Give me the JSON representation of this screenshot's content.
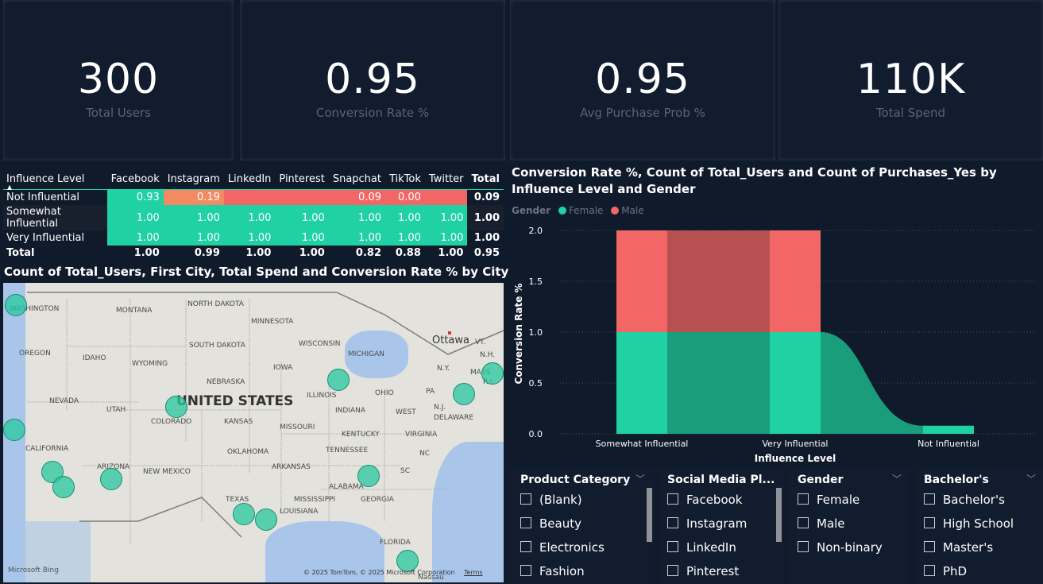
{
  "kpis": [
    {
      "value": "300",
      "label": "Total Users"
    },
    {
      "value": "0.95",
      "label": "Conversion Rate %"
    },
    {
      "value": "0.95",
      "label": "Avg Purchase Prob %"
    },
    {
      "value": "110K",
      "label": "Total Spend"
    }
  ],
  "matrix": {
    "corner": "Influence Level",
    "columns": [
      "Facebook",
      "Instagram",
      "LinkedIn",
      "Pinterest",
      "Snapchat",
      "TikTok",
      "Twitter",
      "Total"
    ],
    "rows": [
      {
        "label": "Not Influential",
        "cells": [
          "0.93",
          "0.19",
          "",
          "",
          "0.09",
          "0.00",
          "",
          "0.09"
        ]
      },
      {
        "label": "Somewhat Influential",
        "cells": [
          "1.00",
          "1.00",
          "1.00",
          "1.00",
          "1.00",
          "1.00",
          "1.00",
          "1.00"
        ]
      },
      {
        "label": "Very Influential",
        "cells": [
          "1.00",
          "1.00",
          "1.00",
          "1.00",
          "1.00",
          "1.00",
          "1.00",
          "1.00"
        ]
      },
      {
        "label": "Total",
        "cells": [
          "1.00",
          "0.99",
          "1.00",
          "1.00",
          "0.82",
          "0.88",
          "1.00",
          "0.95"
        ]
      }
    ]
  },
  "map": {
    "title": "Count of Total_Users, First City, Total Spend and Conversion Rate % by City",
    "country_label": "UNITED STATES",
    "city_label": "Ottawa",
    "states": [
      "WASHINGTON",
      "MONTANA",
      "NORTH DAKOTA",
      "MINNESOTA",
      "OREGON",
      "IDAHO",
      "SOUTH DAKOTA",
      "WISCONSIN",
      "MICHIGAN",
      "WYOMING",
      "IOWA",
      "NEBRASKA",
      "N.H.",
      "MASS.",
      "R.I.",
      "N.Y.",
      "NEVADA",
      "UTAH",
      "ILLINOIS",
      "OHIO",
      "PA",
      "N.J.",
      "COLORADO",
      "KANSAS",
      "INDIANA",
      "WEST",
      "DELAWARE",
      "MISSOURI",
      "KENTUCKY",
      "VIRGINIA",
      "CALIFORNIA",
      "TENNESSEE",
      "NC",
      "OKLAHOMA",
      "ARKANSAS",
      "ARIZONA",
      "NEW MEXICO",
      "SC",
      "ALABAMA",
      "GEORGIA",
      "MISSISSIPPI",
      "TEXAS",
      "LOUISIANA",
      "FLORIDA",
      "Nassau",
      "VT."
    ],
    "attribution": "© 2025 TomTom, © 2025 Microsoft Corporation",
    "terms": "Terms",
    "bing": "Microsoft Bing"
  },
  "chart": {
    "title": "Conversion Rate %, Count of Total_Users and Count of Purchases_Yes by Influence Level and Gender",
    "legend_title": "Gender",
    "colors": {
      "female": "#1fd1a3",
      "male": "#f36666",
      "female_dark": "#1a9d7b",
      "male_dark": "#b85052"
    }
  },
  "chart_data": {
    "type": "bar",
    "title": "Conversion Rate %, Count of Total_Users and Count of Purchases_Yes by Influence Level and Gender",
    "xlabel": "Influence Level",
    "ylabel": "Conversion Rate %",
    "categories": [
      "Somewhat Influential",
      "Very Influential",
      "Not Influential"
    ],
    "series": [
      {
        "name": "Female",
        "values": [
          1.0,
          1.0,
          0.08
        ]
      },
      {
        "name": "Male",
        "values": [
          1.0,
          1.0,
          0.0
        ]
      }
    ],
    "yticks": [
      "0.0",
      "0.5",
      "1.0",
      "1.5",
      "2.0"
    ],
    "ylim": [
      0,
      2
    ],
    "stacked": true,
    "legend": "top-left"
  },
  "slicers": [
    {
      "title": "Product Category",
      "items": [
        "(Blank)",
        "Beauty",
        "Electronics",
        "Fashion"
      ]
    },
    {
      "title": "Social Media Pl...",
      "items": [
        "Facebook",
        "Instagram",
        "LinkedIn",
        "Pinterest"
      ]
    },
    {
      "title": "Gender",
      "items": [
        "Female",
        "Male",
        "Non-binary"
      ]
    },
    {
      "title": "Bachelor's",
      "items": [
        "Bachelor's",
        "High School",
        "Master's",
        "PhD"
      ]
    }
  ]
}
